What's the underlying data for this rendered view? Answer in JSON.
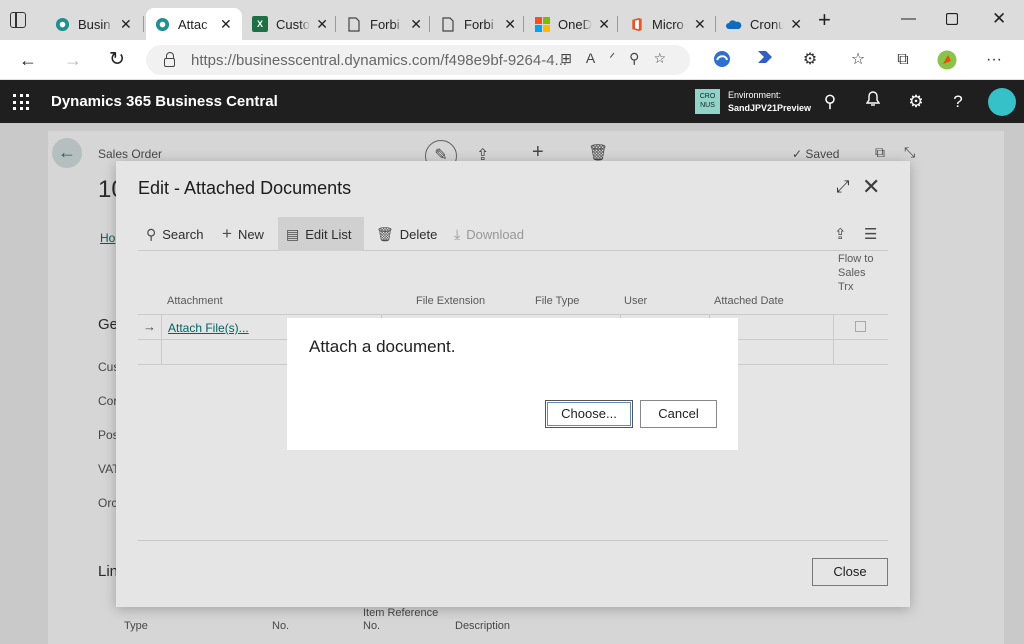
{
  "browser": {
    "tabs": [
      {
        "label": "Busin",
        "icon": "bc-icon",
        "active": false
      },
      {
        "label": "Attac",
        "icon": "bc-icon",
        "active": true
      },
      {
        "label": "Custo",
        "icon": "excel-icon",
        "active": false
      },
      {
        "label": "Forbi",
        "icon": "page-icon",
        "active": false
      },
      {
        "label": "Forbi",
        "icon": "page-icon",
        "active": false
      },
      {
        "label": "OneD",
        "icon": "microsoft-icon",
        "active": false
      },
      {
        "label": "Micro",
        "icon": "office-icon",
        "active": false
      },
      {
        "label": "Cronu",
        "icon": "onedrive-icon",
        "active": false
      }
    ],
    "url_host": "https://businesscentral.dynamics.com",
    "url_path": "/f498e9bf-9264-4..."
  },
  "bc": {
    "title": "Dynamics 365 Business Central",
    "env_badge": "CRO NUS",
    "env_label": "Environment:",
    "env_name": "SandJPV21Preview"
  },
  "background": {
    "breadcrumb": "Sales Order",
    "saved": "✓ Saved",
    "number_prefix": "10",
    "tab_home": "Ho",
    "section_general": "Ge",
    "field1": "Cus",
    "field2": "Cor",
    "field3": "Pos",
    "field4": "VAT",
    "field5": "Orc",
    "section_lines": "Lin",
    "lines_cols": [
      "Type",
      "No.",
      "Item Reference No.",
      "Description"
    ]
  },
  "dialog": {
    "title": "Edit - Attached Documents",
    "actions": {
      "search": "Search",
      "new": "New",
      "edit_list": "Edit List",
      "delete": "Delete",
      "download": "Download"
    },
    "columns": {
      "attachment": "Attachment",
      "file_extension": "File Extension",
      "file_type": "File Type",
      "user": "User",
      "attached_date": "Attached Date",
      "flow": "Flow to Sales Trx"
    },
    "row_link": "Attach File(s)...",
    "close": "Close"
  },
  "modal": {
    "title": "Attach a document.",
    "choose": "Choose...",
    "cancel": "Cancel"
  }
}
